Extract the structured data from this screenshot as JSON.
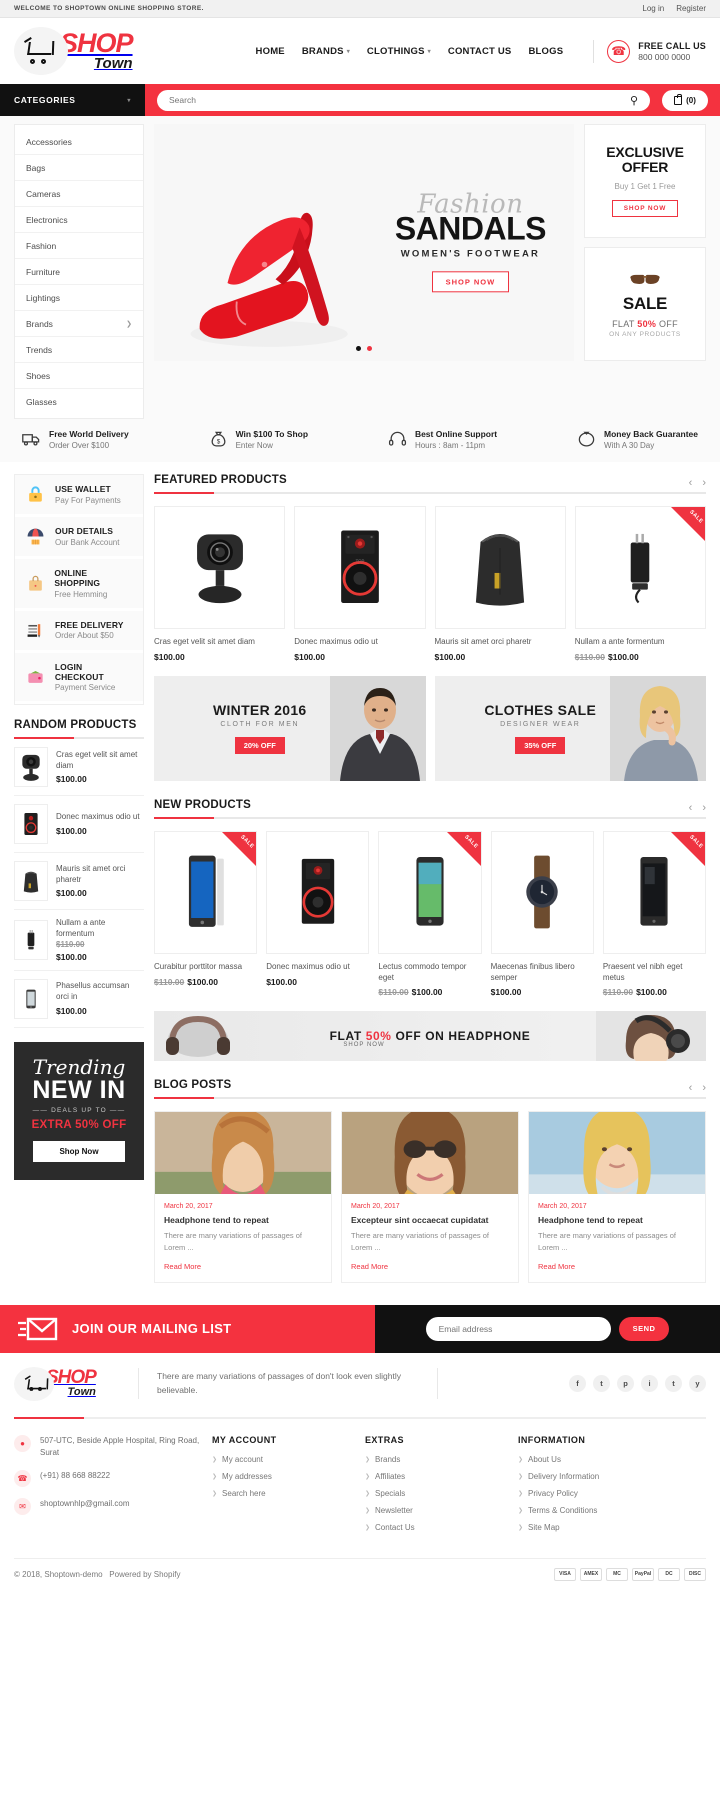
{
  "topbar": {
    "welcome": "WELCOME TO SHOPTOWN ONLINE SHOPPING STORE.",
    "login": "Log in",
    "register": "Register"
  },
  "brand": {
    "shop": "SHOP",
    "town": "Town"
  },
  "nav": [
    {
      "label": "HOME",
      "caret": false
    },
    {
      "label": "BRANDS",
      "caret": true
    },
    {
      "label": "CLOTHINGS",
      "caret": true
    },
    {
      "label": "CONTACT US",
      "caret": false
    },
    {
      "label": "BLOGS",
      "caret": false
    }
  ],
  "call": {
    "title": "FREE CALL US",
    "number": "800 000 0000"
  },
  "search": {
    "categories_label": "CATEGORIES",
    "placeholder": "Search",
    "cart_count": "(0)"
  },
  "categories": [
    {
      "label": "Accessories",
      "arrow": false
    },
    {
      "label": "Bags",
      "arrow": false
    },
    {
      "label": "Cameras",
      "arrow": false
    },
    {
      "label": "Electronics",
      "arrow": false
    },
    {
      "label": "Fashion",
      "arrow": false
    },
    {
      "label": "Furniture",
      "arrow": false
    },
    {
      "label": "Lightings",
      "arrow": false
    },
    {
      "label": "Brands",
      "arrow": true
    },
    {
      "label": "Trends",
      "arrow": false
    },
    {
      "label": "Shoes",
      "arrow": false
    },
    {
      "label": "Glasses",
      "arrow": false
    }
  ],
  "hero": {
    "script": "Fashion",
    "big": "SANDALS",
    "sub": "WOMEN'S FOOTWEAR",
    "cta": "SHOP NOW"
  },
  "promos": [
    {
      "title_line1": "EXCLUSIVE",
      "title_line2": "OFFER",
      "subtitle": "Buy 1 Get 1 Free",
      "button": "SHOP NOW"
    },
    {
      "title": "SALE",
      "flat_pre": "FLAT ",
      "flat_pct": "50%",
      "flat_post": " OFF",
      "note": "ON ANY PRODUCTS"
    }
  ],
  "services": [
    {
      "icon": "truck-icon",
      "t1": "Free World Delivery",
      "t2": "Order Over $100"
    },
    {
      "icon": "money-bag-icon",
      "t1": "Win $100 To Shop",
      "t2": "Enter Now"
    },
    {
      "icon": "headset-icon",
      "t1": "Best Online Support",
      "t2": "Hours : 8am - 11pm"
    },
    {
      "icon": "piggy-bank-icon",
      "t1": "Money Back Guarantee",
      "t2": "With A 30 Day"
    }
  ],
  "widgets": [
    {
      "icon": "lock-icon",
      "t1": "USE WALLET",
      "t2": "Pay For Payments"
    },
    {
      "icon": "umbrella-icon",
      "t1": "OUR DETAILS",
      "t2": "Our Bank Account"
    },
    {
      "icon": "shopping-bag-icon",
      "t1": "ONLINE SHOPPING",
      "t2": "Free Hemming"
    },
    {
      "icon": "invoice-pen-icon",
      "t1": "FREE DELIVERY",
      "t2": "Order About $50"
    },
    {
      "icon": "wallet-icon",
      "t1": "LOGIN CHECKOUT",
      "t2": "Payment Service"
    }
  ],
  "random_products": {
    "title": "RANDOM PRODUCTS",
    "items": [
      {
        "name": "Cras eget velit sit amet diam",
        "price": "$100.00",
        "old_price": "",
        "thumb": "webcam"
      },
      {
        "name": "Donec maximus odio ut",
        "price": "$100.00",
        "old_price": "",
        "thumb": "speaker"
      },
      {
        "name": "Mauris sit amet orci pharetr",
        "price": "$100.00",
        "old_price": "",
        "thumb": "backpack"
      },
      {
        "name": "Nullam a ante formentum",
        "price": "$100.00",
        "old_price": "$110.00",
        "thumb": "charger"
      },
      {
        "name": "Phasellus accumsan orci in",
        "price": "$100.00",
        "old_price": "",
        "thumb": "phone"
      }
    ]
  },
  "trending": {
    "script": "Trending",
    "new_in": "NEW IN",
    "deals": "—— DEALS UP TO ——",
    "extra": "EXTRA 50% OFF",
    "button": "Shop Now"
  },
  "featured": {
    "title": "FEATURED PRODUCTS",
    "items": [
      {
        "name": "Cras eget velit sit amet diam",
        "price": "$100.00",
        "old_price": "",
        "sale": false,
        "img": "webcam"
      },
      {
        "name": "Donec maximus odio ut",
        "price": "$100.00",
        "old_price": "",
        "sale": false,
        "img": "speaker"
      },
      {
        "name": "Mauris sit amet orci pharetr",
        "price": "$100.00",
        "old_price": "",
        "sale": false,
        "img": "backpack"
      },
      {
        "name": "Nullam a ante formentum",
        "price": "$100.00",
        "old_price": "$110.00",
        "sale": true,
        "img": "charger"
      }
    ],
    "sale_label": "SALE"
  },
  "mid_banners": [
    {
      "title": "WINTER 2016",
      "sub": "CLOTH FOR MEN",
      "badge": "20% OFF"
    },
    {
      "title": "CLOTHES SALE",
      "sub": "DESIGNER WEAR",
      "badge": "35% OFF"
    }
  ],
  "new_products": {
    "title": "NEW PRODUCTS",
    "sale_label": "SALE",
    "items": [
      {
        "name": "Curabitur porttitor massa",
        "price": "$100.00",
        "old_price": "$110.00",
        "sale": true,
        "img": "phone-blue"
      },
      {
        "name": "Donec maximus odio ut",
        "price": "$100.00",
        "old_price": "",
        "sale": false,
        "img": "speaker"
      },
      {
        "name": "Lectus commodo tempor eget",
        "price": "$100.00",
        "old_price": "$110.00",
        "sale": true,
        "img": "phone-green"
      },
      {
        "name": "Maecenas finibus libero semper",
        "price": "$100.00",
        "old_price": "",
        "sale": false,
        "img": "watch"
      },
      {
        "name": "Praesent vel nibh eget metus",
        "price": "$100.00",
        "old_price": "$110.00",
        "sale": true,
        "img": "phone-dark"
      }
    ]
  },
  "headphone_banner": {
    "pre": "FLAT ",
    "pct": "50%",
    "post": " OFF ON HEADPHONE",
    "sub": "SHOP NOW"
  },
  "blog": {
    "title": "BLOG POSTS",
    "posts": [
      {
        "date": "March 20, 2017",
        "title": "Headphone tend to repeat",
        "desc": "There are many variations of passages of Lorem ...",
        "more": "Read More"
      },
      {
        "date": "March 20, 2017",
        "title": "Excepteur sint occaecat cupidatat",
        "desc": "There are many variations of passages of Lorem ...",
        "more": "Read More"
      },
      {
        "date": "March 20, 2017",
        "title": "Headphone tend to repeat",
        "desc": "There are many variations of passages of Lorem ...",
        "more": "Read More"
      }
    ]
  },
  "newsletter": {
    "title": "JOIN OUR MAILING LIST",
    "placeholder": "Email address",
    "send": "SEND"
  },
  "footer": {
    "desc": "There are many variations of passages of don't look even slightly believable.",
    "socials": [
      "f",
      "t",
      "p",
      "i",
      "t",
      "y"
    ],
    "contact": [
      {
        "icon": "location-icon",
        "text": "507-UTC, Beside Apple Hospital, Ring Road, Surat"
      },
      {
        "icon": "phone-icon",
        "text": "(+91) 88 668 88222"
      },
      {
        "icon": "mail-icon",
        "text": "shoptownhlp@gmail.com"
      }
    ],
    "columns": [
      {
        "head": "MY ACCOUNT",
        "links": [
          "My account",
          "My addresses",
          "Search here"
        ]
      },
      {
        "head": "EXTRAS",
        "links": [
          "Brands",
          "Affiliates",
          "Specials",
          "Newsletter",
          "Contact Us"
        ]
      },
      {
        "head": "INFORMATION",
        "links": [
          "About Us",
          "Delivery Information",
          "Privacy Policy",
          "Terms & Conditions",
          "Site Map"
        ]
      }
    ],
    "copyright": "© 2018, Shoptown-demo",
    "powered": "Powered by Shopify",
    "cards": [
      "VISA",
      "AMEX",
      "MC",
      "PayPal",
      "DC",
      "DISC"
    ]
  }
}
